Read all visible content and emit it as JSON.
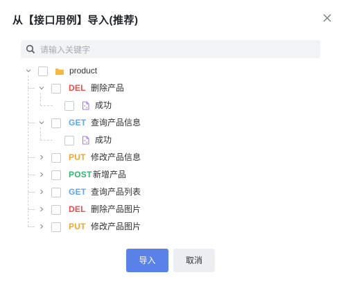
{
  "dialog": {
    "title": "从【接口用例】导入(推荐)",
    "close_icon": "close-icon"
  },
  "search": {
    "placeholder": "请输入关键字",
    "icon": "search-icon"
  },
  "colors": {
    "DEL": "#f04b4b",
    "GET": "#5aa7ef",
    "PUT": "#f4a524",
    "POST": "#2eb872",
    "folder": "#f6b93b",
    "result_icon": "#a67de8",
    "primary": "#5b82e8"
  },
  "tree": {
    "root": {
      "label": "product",
      "icon": "folder-icon",
      "expanded": true
    },
    "items": [
      {
        "method": "DEL",
        "name": "删除产品",
        "expanded": true,
        "children": [
          {
            "label": "成功",
            "icon": "test-case-icon"
          }
        ]
      },
      {
        "method": "GET",
        "name": "查询产品信息",
        "expanded": true,
        "children": [
          {
            "label": "成功",
            "icon": "test-case-icon"
          }
        ]
      },
      {
        "method": "PUT",
        "name": "修改产品信息",
        "expanded": false
      },
      {
        "method": "POST",
        "name": "新增产品",
        "expanded": false
      },
      {
        "method": "GET",
        "name": "查询产品列表",
        "expanded": false
      },
      {
        "method": "DEL",
        "name": "删除产品图片",
        "expanded": false
      },
      {
        "method": "PUT",
        "name": "修改产品图片",
        "expanded": false
      }
    ]
  },
  "footer": {
    "import_label": "导入",
    "cancel_label": "取消"
  }
}
